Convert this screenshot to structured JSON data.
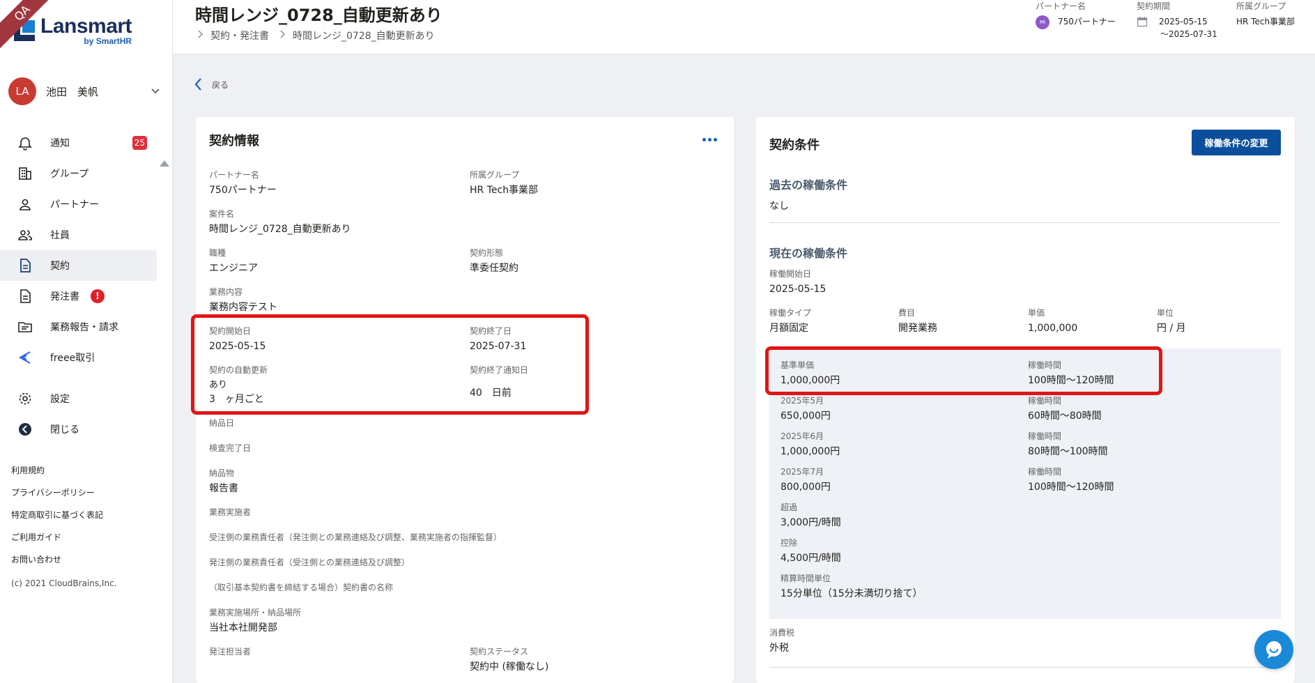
{
  "ribbon": "QA",
  "logo": {
    "title": "Lansmart",
    "subtitle": "by SmartHR"
  },
  "user": {
    "initials": "LA",
    "name": "池田　美帆"
  },
  "nav": [
    {
      "label": "通知",
      "icon": "bell-icon",
      "badge": "25"
    },
    {
      "label": "グループ",
      "icon": "building-icon"
    },
    {
      "label": "パートナー",
      "icon": "person-icon"
    },
    {
      "label": "社員",
      "icon": "people-icon"
    },
    {
      "label": "契約",
      "icon": "document-icon",
      "active": true
    },
    {
      "label": "発注書",
      "icon": "document-icon",
      "alert": "!"
    },
    {
      "label": "業務報告・請求",
      "icon": "folder-icon"
    },
    {
      "label": "freee取引",
      "icon": "freee-icon"
    },
    {
      "label": "設定",
      "icon": "gear-icon"
    },
    {
      "label": "閉じる",
      "icon": "arrow-left-circle-icon"
    }
  ],
  "footer": {
    "links": [
      "利用規約",
      "プライバシーポリシー",
      "特定商取引に基づく表記",
      "ご利用ガイド",
      "お問い合わせ"
    ],
    "copyright": "(c) 2021 CloudBrains,Inc."
  },
  "header": {
    "title": "時間レンジ_0728_自動更新あり",
    "breadcrumbs": [
      "契約・発注書",
      "時間レンジ_0728_自動更新あり"
    ],
    "partner": {
      "label": "パートナー名",
      "avatar": "MI",
      "value": "750パートナー"
    },
    "period": {
      "label": "契約期間",
      "start": "2025-05-15",
      "end": "〜2025-07-31"
    },
    "group": {
      "label": "所属グループ",
      "value": "HR Tech事業部"
    }
  },
  "back_label": "戻る",
  "contract_info": {
    "title": "契約情報",
    "partner_name": {
      "label": "パートナー名",
      "value": "750パートナー"
    },
    "group": {
      "label": "所属グループ",
      "value": "HR Tech事業部"
    },
    "project_name": {
      "label": "案件名",
      "value": "時間レンジ_0728_自動更新あり"
    },
    "job_type": {
      "label": "職種",
      "value": "エンジニア"
    },
    "contract_form": {
      "label": "契約形態",
      "value": "準委任契約"
    },
    "work_content": {
      "label": "業務内容",
      "value": "業務内容テスト"
    },
    "start_date": {
      "label": "契約開始日",
      "value": "2025-05-15"
    },
    "end_date": {
      "label": "契約終了日",
      "value": "2025-07-31"
    },
    "auto_renew": {
      "label": "契約の自動更新",
      "value1": "あり",
      "value2": "3　ヶ月ごと"
    },
    "end_notice": {
      "label": "契約終了通知日",
      "value": "40　日前"
    },
    "delivery_date": {
      "label": "納品日"
    },
    "inspection_date": {
      "label": "検査完了日"
    },
    "deliverable": {
      "label": "納品物",
      "value": "報告書"
    },
    "implementer": {
      "label": "業務実施者"
    },
    "vendor_manager": {
      "label": "受注側の業務責任者（発注側との業務連絡及び調整、業務実施者の指揮監督）"
    },
    "client_manager": {
      "label": "発注側の業務責任者（受注側との業務連絡及び調整）"
    },
    "master_contract": {
      "label": "（取引基本契約書を締結する場合）契約書の名称"
    },
    "work_place": {
      "label": "業務実施場所・納品場所",
      "value": "当社本社開発部"
    },
    "order_person": {
      "label": "発注担当者"
    },
    "status": {
      "label": "契約ステータス",
      "value": "契約中 (稼働なし)"
    }
  },
  "conditions": {
    "title": "契約条件",
    "change_button": "稼働条件の変更",
    "past": {
      "title": "過去の稼働条件",
      "value": "なし"
    },
    "current": {
      "title": "現在の稼働条件",
      "start": {
        "label": "稼働開始日",
        "value": "2025-05-15"
      },
      "type": {
        "label": "稼働タイプ",
        "value": "月額固定"
      },
      "item": {
        "label": "費目",
        "value": "開発業務"
      },
      "unit_price": {
        "label": "単価",
        "value": "1,000,000"
      },
      "unit": {
        "label": "単位",
        "value": "円 / 月"
      }
    },
    "base": {
      "price_label": "基準単価",
      "price": "1,000,000円",
      "hours_label": "稼働時間",
      "hours": "100時間〜120時間"
    },
    "months": [
      {
        "label": "2025年5月",
        "price": "650,000円",
        "hours_label": "稼働時間",
        "hours": "60時間〜80時間"
      },
      {
        "label": "2025年6月",
        "price": "1,000,000円",
        "hours_label": "稼働時間",
        "hours": "80時間〜100時間"
      },
      {
        "label": "2025年7月",
        "price": "800,000円",
        "hours_label": "稼働時間",
        "hours": "100時間〜120時間"
      }
    ],
    "overtime": {
      "label": "超過",
      "value": "3,000円/時間"
    },
    "deduction": {
      "label": "控除",
      "value": "4,500円/時間"
    },
    "rounding": {
      "label": "精算時間単位",
      "value": "15分単位（15分未満切り捨て）"
    },
    "tax": {
      "label": "消費税",
      "value": "外税"
    }
  },
  "colors": {
    "accent": "#0b4f9c",
    "highlight": "#e01515",
    "badge": "#e0303a"
  }
}
